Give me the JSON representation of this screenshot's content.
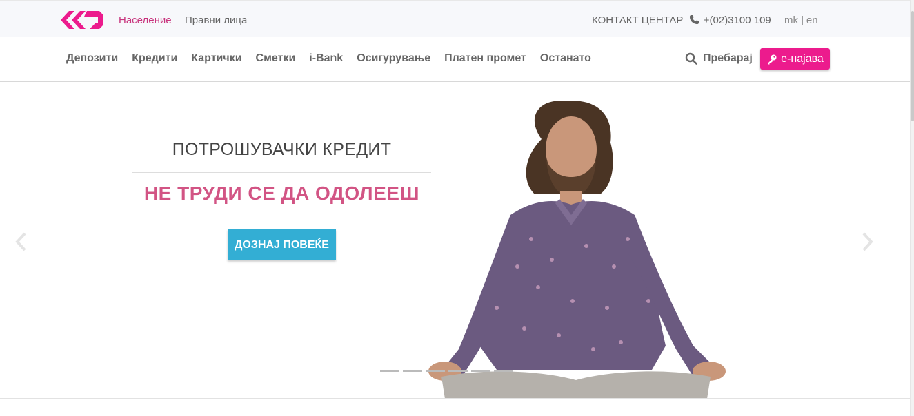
{
  "topbar": {
    "segments": {
      "personal": "Население",
      "legal": "Правни лица"
    },
    "contact": {
      "label": "КОНТАКТ ЦЕНТАР",
      "phone": "+(02)3100 109"
    },
    "languages": {
      "mk": "mk",
      "separator": "|",
      "en": "en"
    }
  },
  "nav": {
    "items": [
      "Депозити",
      "Кредити",
      "Картички",
      "Сметки",
      "i-Bank",
      "Осигурување",
      "Платен промет",
      "Останато"
    ],
    "search_label": "Пребарај",
    "login_label": "е-најава"
  },
  "hero": {
    "subtitle": "ПОТРОШУВАЧКИ КРЕДИТ",
    "title": "НЕ ТРУДИ СЕ ДА ОДОЛЕЕШ",
    "cta_label": "ДОЗНАЈ ПОВЕЌЕ",
    "slide_count": 6
  },
  "colors": {
    "brand_pink": "#ec1b8d",
    "active_segment": "#c8347d",
    "hero_title": "#d25484",
    "cta_blue": "#33aed4"
  },
  "icons": [
    "logo-icon",
    "phone-icon",
    "search-icon",
    "key-icon",
    "chevron-left-icon",
    "chevron-right-icon"
  ]
}
